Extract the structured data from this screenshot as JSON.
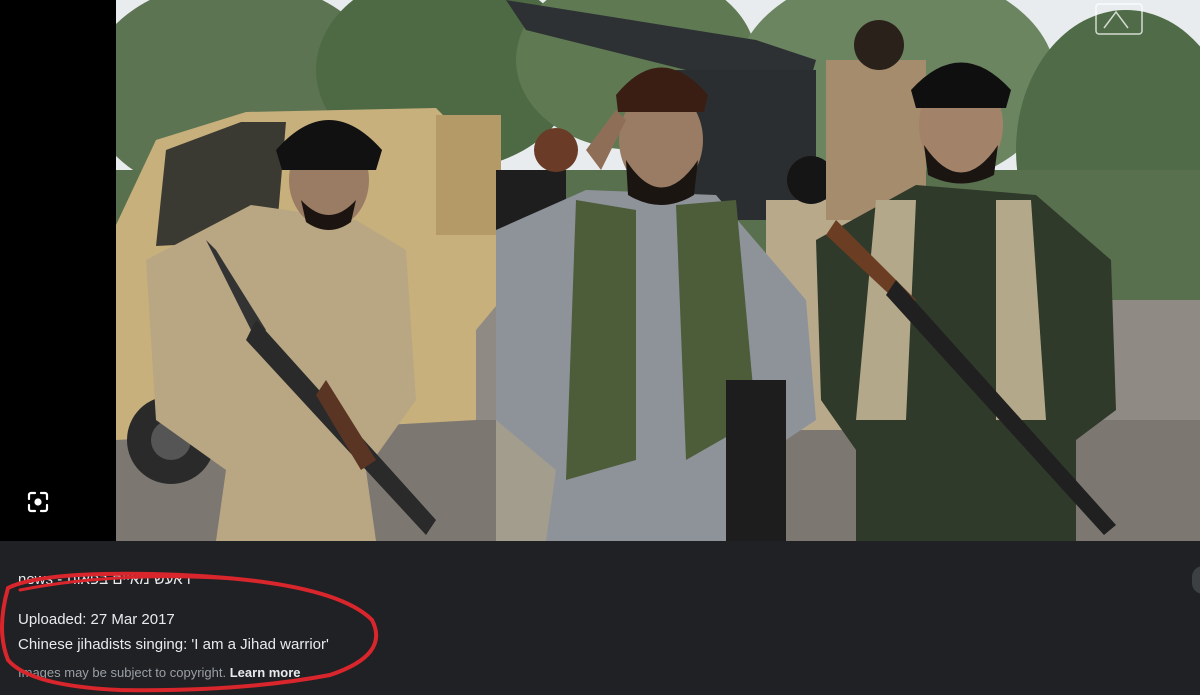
{
  "viewer": {
    "lens_icon": "lens-scan-icon",
    "watermark_icon": "watermark-logo-icon"
  },
  "info": {
    "source_line": "ראעש מאיים בפאות - news",
    "uploaded": "Uploaded: 27 Mar 2017",
    "caption": "Chinese jihadists singing: 'I am a Jihad warrior'",
    "copyright_prefix": "Images may be subject to copyright.",
    "learn_more": "Learn more"
  },
  "colors": {
    "panel_bg": "#202124",
    "annotation_red": "#d8262c"
  }
}
